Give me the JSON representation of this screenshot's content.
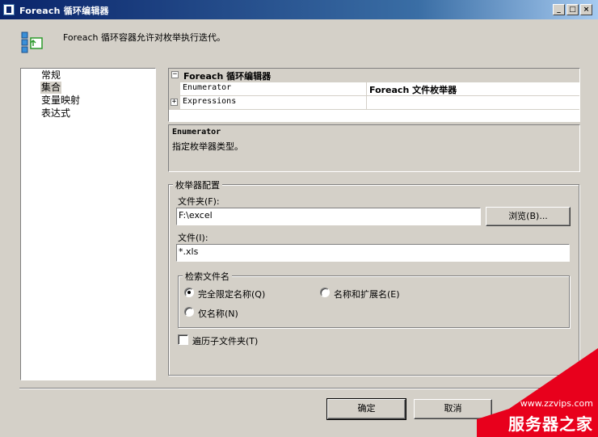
{
  "window": {
    "title": "Foreach 循环编辑器",
    "controls": {
      "minimize": "_",
      "maximize": "□",
      "close": "×"
    }
  },
  "description": {
    "icon": "foreach-loop-icon",
    "text": "Foreach 循环容器允许对枚举执行迭代。"
  },
  "nav": {
    "items": [
      {
        "label": "常规",
        "selected": false
      },
      {
        "label": "集合",
        "selected": true
      },
      {
        "label": "变量映射",
        "selected": false
      },
      {
        "label": "表达式",
        "selected": false
      }
    ]
  },
  "property_grid": {
    "header": "Foreach 循环编辑器",
    "rows": [
      {
        "name": "Enumerator",
        "value": "Foreach 文件枚举器"
      },
      {
        "name": "Expressions",
        "value": ""
      }
    ]
  },
  "help": {
    "title": "Enumerator",
    "body": "指定枚举器类型。"
  },
  "enumerator_config": {
    "group_label": "枚举器配置",
    "folder_label": "文件夹(F):",
    "folder_value": "F:\\excel",
    "browse_label": "浏览(B)...",
    "files_label": "文件(I):",
    "files_value": "*.xls",
    "retrieve": {
      "group_label": "检索文件名",
      "options": [
        {
          "label": "完全限定名称(Q)",
          "checked": true
        },
        {
          "label": "名称和扩展名(E)",
          "checked": false
        },
        {
          "label": "仅名称(N)",
          "checked": false
        }
      ]
    },
    "traverse_label": "遍历子文件夹(T)",
    "traverse_checked": false
  },
  "footer": {
    "ok_label": "确定",
    "cancel_label": "取消"
  },
  "watermark": {
    "url": "www.zzvips.com",
    "brand": "服务器之家",
    "color": "#e8001c"
  }
}
